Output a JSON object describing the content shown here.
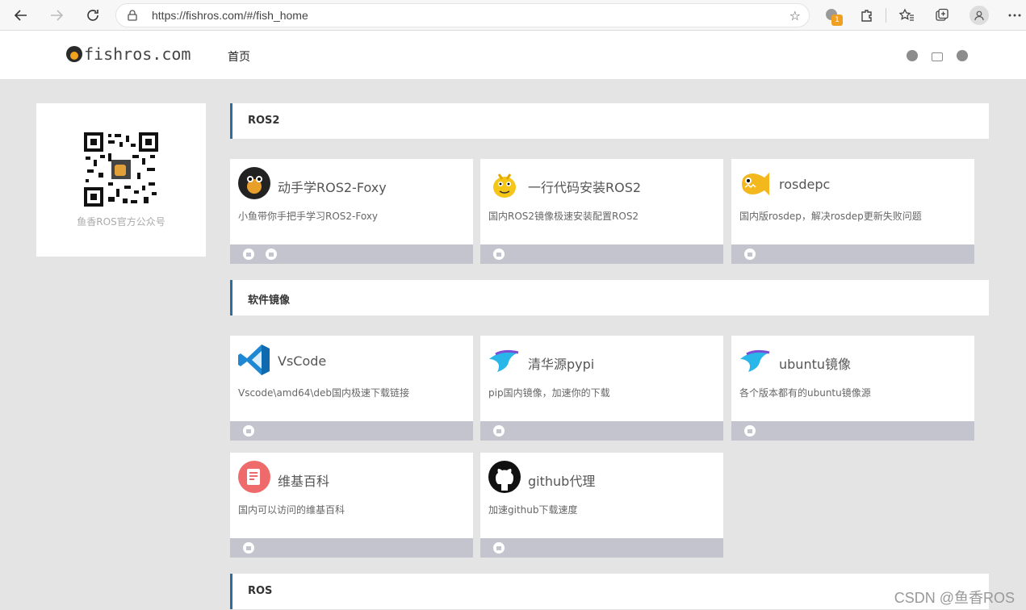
{
  "browser": {
    "url": "https://fishros.com/#/fish_home",
    "extension_badge": "1",
    "icons": [
      "back-icon",
      "forward-icon",
      "refresh-icon",
      "lock-icon",
      "add-favorite-icon",
      "extension-icon",
      "puzzle-icon",
      "favorites-icon",
      "collections-icon",
      "profile-icon",
      "more-icon"
    ]
  },
  "header": {
    "logo_text": "fishros.com",
    "nav_home": "首页",
    "icons": [
      "github-icon",
      "bilibili-icon",
      "zhihu-icon"
    ]
  },
  "sidebar": {
    "qr_label": "鱼香ROS官方公众号"
  },
  "sections": [
    {
      "title": "ROS2"
    },
    {
      "title": "软件镜像"
    },
    {
      "title": "ROS"
    }
  ],
  "cards": [
    {
      "title": "动手学ROS2-Foxy",
      "desc": "小鱼带你手把手学习ROS2-Foxy"
    },
    {
      "title": "一行代码安装ROS2",
      "desc": "国内ROS2镜像极速安装配置ROS2"
    },
    {
      "title": "rosdepc",
      "desc": "国内版rosdep，解决rosdep更新失败问题"
    },
    {
      "title": "VsCode",
      "desc": "Vscode\\amd64\\deb国内极速下载链接"
    },
    {
      "title": "清华源pypi",
      "desc": "pip国内镜像，加速你的下载"
    },
    {
      "title": "ubuntu镜像",
      "desc": "各个版本都有的ubuntu镜像源"
    },
    {
      "title": "维基百科",
      "desc": "国内可以访问的维基百科"
    },
    {
      "title": "github代理",
      "desc": "加速github下载速度"
    }
  ],
  "watermark": "CSDN @鱼香ROS",
  "colors": {
    "accent": "#2e6fa1",
    "card_footer": "#c4c4cf",
    "background": "#e4e4e4"
  }
}
